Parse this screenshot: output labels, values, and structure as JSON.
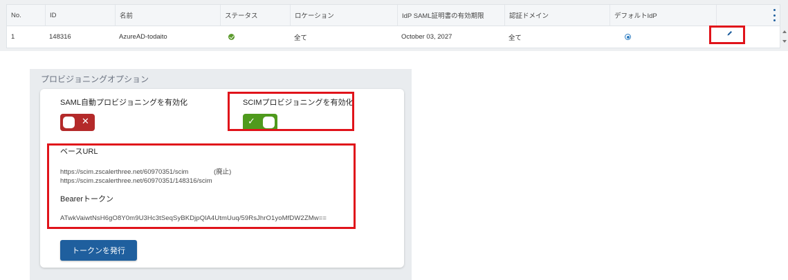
{
  "table": {
    "headers": [
      "No.",
      "ID",
      "名前",
      "ステータス",
      "ロケーション",
      "IdP SAML証明書の有効期限",
      "認証ドメイン",
      "デフォルトIdP",
      ""
    ],
    "row": {
      "no": "1",
      "id": "148316",
      "name": "AzureAD-todaito",
      "status": "enabled",
      "location": "全て",
      "cert_expiry": "October 03, 2027",
      "auth_domain": "全て",
      "default_idp": true
    },
    "icons": [
      "more-options-icon",
      "status-check-icon",
      "radio-selected-icon",
      "edit-pencil-icon"
    ]
  },
  "provisioning": {
    "section_title": "プロビジョニングオプション",
    "saml_label": "SAML自動プロビジョニングを有効化",
    "saml_enabled": false,
    "scim_label": "SCIMプロビジョニングを有効化",
    "scim_enabled": true,
    "base_url_label": "ベースURL",
    "base_urls": [
      {
        "url": "https://scim.zscalerthree.net/60970351/scim",
        "note": "(廃止)"
      },
      {
        "url": "https://scim.zscalerthree.net/60970351/148316/scim",
        "note": ""
      }
    ],
    "bearer_label": "Bearerトークン",
    "bearer_token": "ATwkVaiwtNsH6gO8Y0m9U3Hc3tSeqSyBKDjpQlA4UtmUuq/59RsJhrO1yoMfDW2ZMw==",
    "issue_button": "トークンを発行"
  },
  "colors": {
    "accent": "#1f5f9e",
    "toggle_off": "#b42a2a",
    "toggle_on": "#4f9a1d",
    "highlight": "#e0131a",
    "status_ok": "#5b9a2c"
  }
}
